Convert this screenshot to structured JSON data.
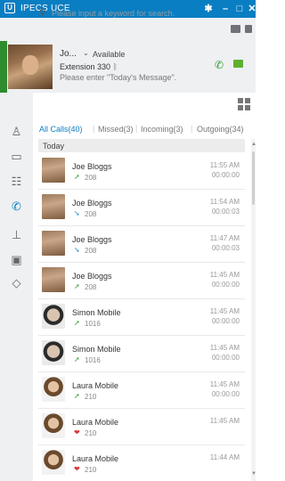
{
  "app": {
    "logo": "U",
    "title": "IPECS UCE",
    "controls": [
      "gear-icon",
      "minimize-icon",
      "restore-icon",
      "close-icon"
    ]
  },
  "profile": {
    "name": "Jo...",
    "status": "Available",
    "extension": "Extension 330",
    "message_placeholder": "Please enter \"Today's Message\".",
    "accent_color": "#2e8b2e"
  },
  "search": {
    "placeholder": "Please input a keyword for search."
  },
  "filters": {
    "all": "All Calls(40)",
    "missed": "Missed(3)",
    "incoming": "Incoming(3)",
    "outgoing": "Outgoing(34)"
  },
  "calls": {
    "group": "Today",
    "rows": [
      {
        "name": "Joe Bloggs",
        "ext": "208",
        "time": "11:55 AM",
        "duration": "00:00:00",
        "type": "outgoing",
        "photo": "joe"
      },
      {
        "name": "Joe Bloggs",
        "ext": "208",
        "time": "11:54 AM",
        "duration": "00:00:03",
        "type": "incoming",
        "photo": "joe"
      },
      {
        "name": "Joe Bloggs",
        "ext": "208",
        "time": "11:47 AM",
        "duration": "00:00:03",
        "type": "incoming",
        "photo": "joe"
      },
      {
        "name": "Joe Bloggs",
        "ext": "208",
        "time": "11:45 AM",
        "duration": "00:00:00",
        "type": "outgoing",
        "photo": "joe"
      },
      {
        "name": "Simon Mobile",
        "ext": "1016",
        "time": "11:45 AM",
        "duration": "00:00:00",
        "type": "outgoing",
        "photo": "simon"
      },
      {
        "name": "Simon Mobile",
        "ext": "1016",
        "time": "11:45 AM",
        "duration": "00:00:00",
        "type": "outgoing",
        "photo": "simon"
      },
      {
        "name": "Laura Mobile",
        "ext": "210",
        "time": "11:45 AM",
        "duration": "00:00:00",
        "type": "outgoing",
        "photo": "laura"
      },
      {
        "name": "Laura Mobile",
        "ext": "210",
        "time": "11:45 AM",
        "duration": "",
        "type": "missed",
        "photo": "laura"
      },
      {
        "name": "Laura Mobile",
        "ext": "210",
        "time": "11:44 AM",
        "duration": "",
        "type": "missed",
        "photo": "laura"
      }
    ]
  },
  "colors": {
    "brand": "#0a7ec2",
    "outgoing": "#2e9b2e",
    "incoming": "#1e88d2",
    "missed": "#d8393c"
  }
}
